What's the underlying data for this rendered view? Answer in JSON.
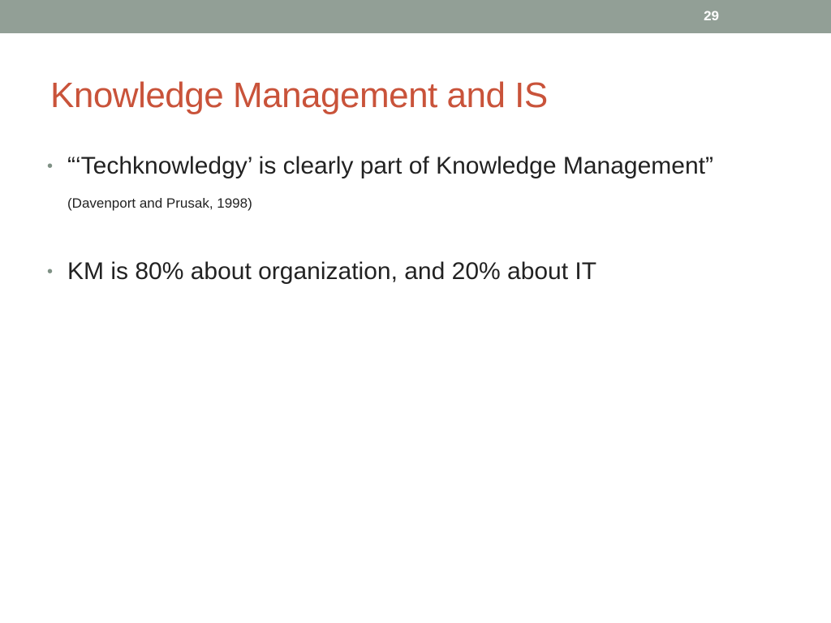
{
  "slide": {
    "number": "29",
    "title": "Knowledge Management and IS",
    "bullet_marker": "•",
    "bullets": [
      {
        "text": "“‘Techknowledgy’ is clearly part of Knowledge Management”",
        "citation": "(Davenport and Prusak, 1998)"
      },
      {
        "text": "KM is 80% about organization, and 20% about IT"
      }
    ]
  },
  "colors": {
    "top_bar": "#929f96",
    "title": "#c9533a",
    "body_text": "#222222",
    "bullet_marker": "#7f9185"
  }
}
